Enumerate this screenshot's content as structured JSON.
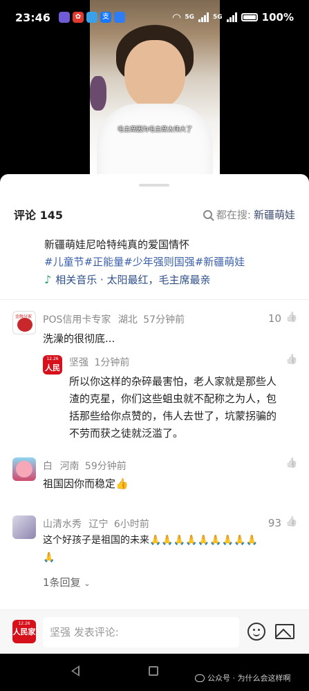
{
  "status_bar": {
    "time": "23:46",
    "net1": "5G",
    "net2": "5G",
    "battery": "100%",
    "apps": [
      {
        "name": "flower-app-icon",
        "glyph": "",
        "color": "#6f5bd6"
      },
      {
        "name": "weibo-icon",
        "glyph": "✿",
        "color": "#e23a2e"
      },
      {
        "name": "cloud-app-icon",
        "glyph": "",
        "color": "#3aa0ea"
      },
      {
        "name": "alipay-icon",
        "glyph": "支",
        "color": "#1677ff"
      },
      {
        "name": "circle-app-icon",
        "glyph": "",
        "color": "#2e7cf6"
      }
    ]
  },
  "video": {
    "caption": "毛主席因为毛主席太伟大了"
  },
  "sheet": {
    "title": "评论 145",
    "search_prefix": "都在搜:",
    "search_term": "新疆萌娃"
  },
  "description": {
    "text": "新疆萌娃尼哈特纯真的爱国情怀",
    "tags": "#儿童节#正能量#少年强则国强#新疆萌娃",
    "music": "相关音乐 · 太阳最红，毛主席最亲"
  },
  "comments": [
    {
      "name": "POS信用卡专家",
      "location": "湖北",
      "time": "57分钟前",
      "text": "洗澡的很彻底...",
      "likes": "10",
      "avatar_label": "金融分家"
    },
    {
      "name": "坚强",
      "location": "",
      "time": "1分钟前",
      "text_lines": [
        "所以你这样的杂碎最害怕，老人家就是那些人",
        "渣的克星，你们这些蛆虫就不配称之为人，包",
        "括那些给你点赞的，伟人去世了，坑蒙拐骗的",
        "不劳而获之徒就泛滥了。"
      ],
      "likes": "",
      "avatar_date": "12.26",
      "avatar_name": "人民家"
    },
    {
      "name": "白",
      "location": "河南",
      "time": "59分钟前",
      "text": "祖国因你而稳定👍",
      "likes": ""
    },
    {
      "name": "山清水秀",
      "location": "辽宁",
      "time": "6小时前",
      "text_lines": [
        "这个好孩子是祖国的未来🙏🙏🙏🙏🙏🙏🙏🙏🙏",
        "🙏"
      ],
      "likes": "93",
      "replies": "1条回复"
    }
  ],
  "input_bar": {
    "avatar_date": "12.26",
    "avatar_name": "人民家",
    "placeholder": "坚强  发表评论:"
  },
  "watermark": "公众号 · 为什么会这样啊"
}
